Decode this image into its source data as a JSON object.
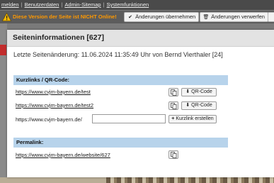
{
  "topnav": {
    "items": [
      "melden",
      "Benutzerdaten",
      "Admin-Sitemap",
      "Systemfunktionen"
    ],
    "separator": "|"
  },
  "statusbar": {
    "warning": "Diese Version der Seite ist NICHT Online!",
    "apply_label": "Änderungen übernehmen",
    "discard_label": "Änderungen verwerfen",
    "warning_color": "#ff9900"
  },
  "modal": {
    "title": "Seiteninformationen [627]",
    "last_change": "Letzte Seitenänderung: 11.06.2024 11:35:49 Uhr von Bernd Vierthaler [24]",
    "shortlinks": {
      "heading": "Kurzlinks / QR-Code:",
      "links": [
        "https://www.cvjm-bayern.de/test",
        "https://www.cvjm-bayern.de/test2"
      ],
      "qr_label": "QR-Code",
      "prefix": "https://www.cvjm-bayern.de/",
      "input_value": "",
      "create_label": "Kurzlink erstellen"
    },
    "permalink": {
      "heading": "Permalink:",
      "url": "https://www.cvjm-bayern.de/website/627"
    },
    "section_color": "#b7d3eb"
  }
}
